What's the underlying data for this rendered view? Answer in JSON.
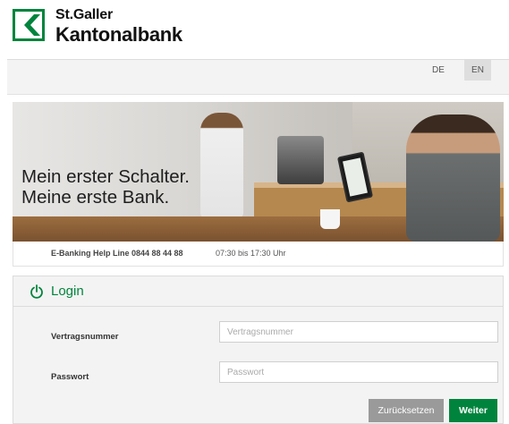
{
  "brand": {
    "name_line1": "St.Galler",
    "name_line2": "Kantonalbank",
    "logo_icon": "skgb-arrow-logo-icon",
    "color": "#00843d"
  },
  "language": {
    "options": [
      "DE",
      "EN"
    ],
    "active": "EN"
  },
  "banner": {
    "slogan_line1": "Mein erster Schalter.",
    "slogan_line2": "Meine erste Bank."
  },
  "helpline": {
    "label": "E-Banking Help Line 0844 88 44 88",
    "hours": "07:30 bis 17:30 Uhr"
  },
  "login": {
    "icon": "power-icon",
    "title": "Login",
    "contract_label": "Vertragsnummer",
    "contract_value": "",
    "contract_placeholder": "Vertragsnummer",
    "password_label": "Passwort",
    "password_value": "",
    "password_placeholder": "Passwort",
    "reset_label": "Zurücksetzen",
    "next_label": "Weiter"
  },
  "colors": {
    "accent": "#00843d",
    "reset_button": "#9a9a9a"
  }
}
